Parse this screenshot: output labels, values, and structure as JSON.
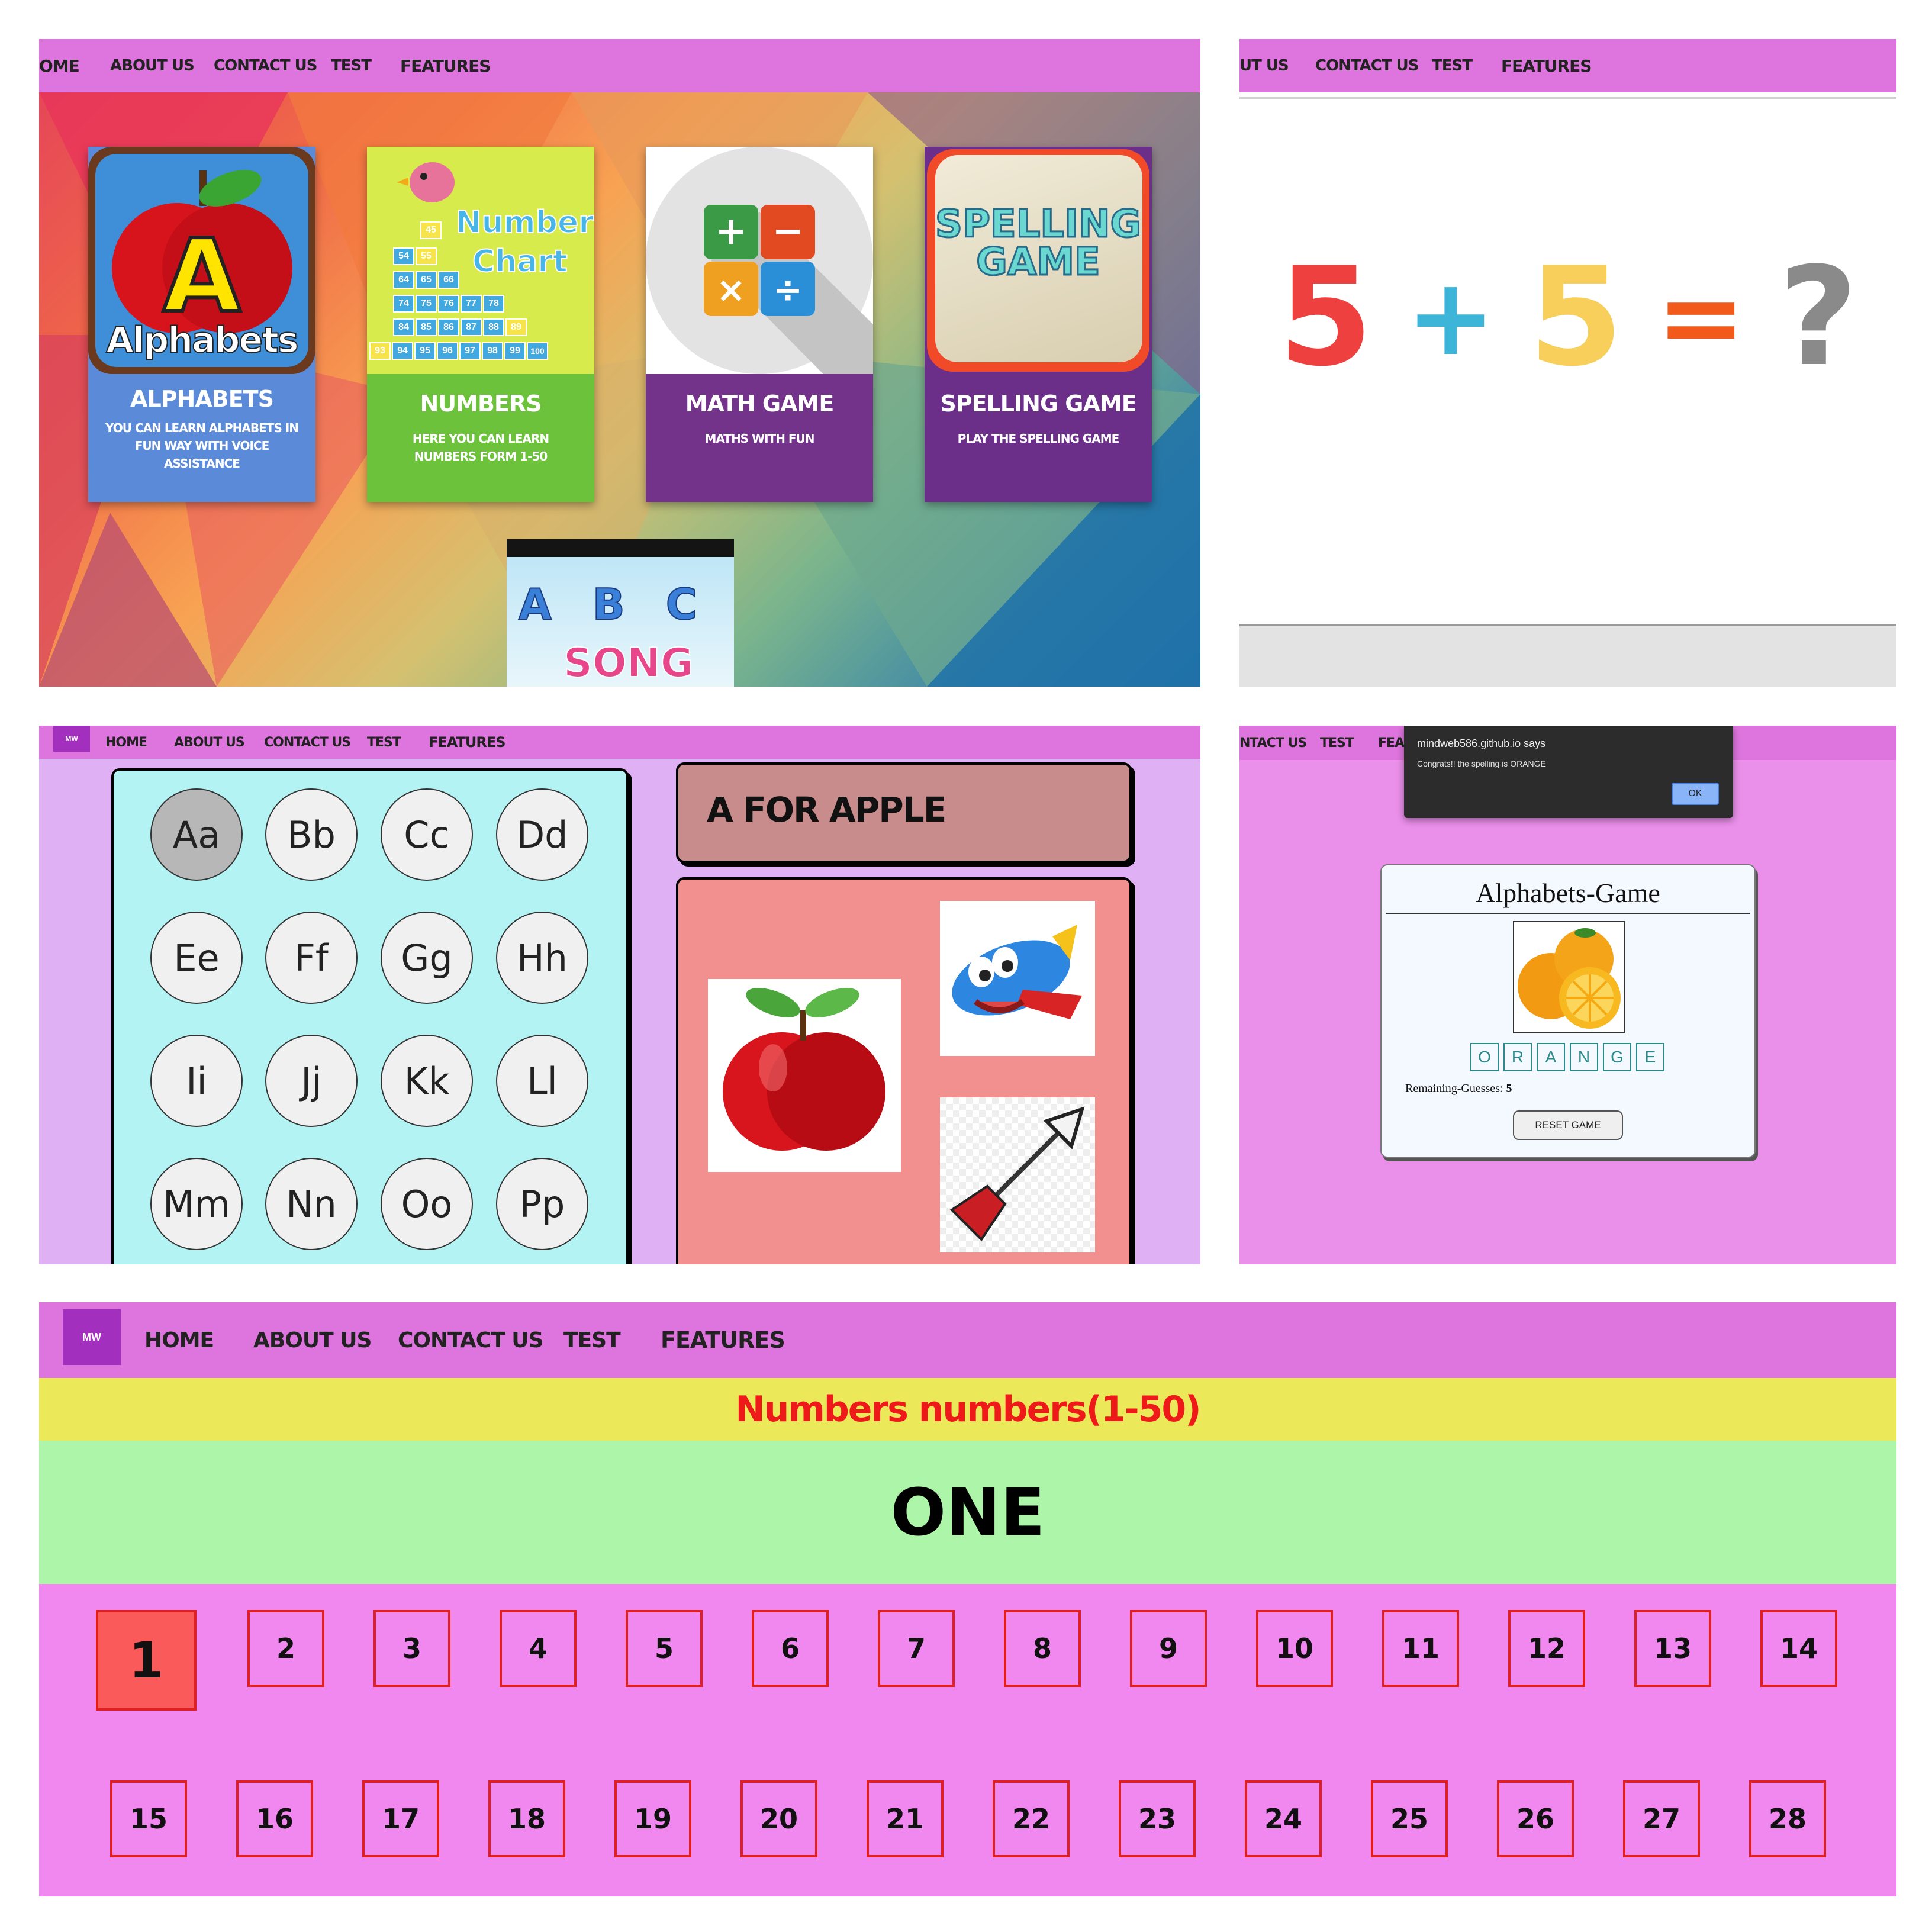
{
  "nav": {
    "home": "Home",
    "about": "About us",
    "contact": "Contact us",
    "test": "Test",
    "features": "Features",
    "home_cut": "ome",
    "about_cut": "UT US",
    "contact_cut": "NTACT US",
    "features_cut": "FEA",
    "logo_text": "MW"
  },
  "panel1": {
    "cards": [
      {
        "image_title": "Alphabets",
        "image_letter": "A",
        "title": "Alphabets",
        "description": "You can learn alphabets in fun way with voice assistance",
        "color": "#5b8bd8"
      },
      {
        "image_title_1": "Number",
        "image_title_2": "Chart",
        "title": "Numbers",
        "description": "Here you can learn numbers form 1-50",
        "color": "#6cc23a"
      },
      {
        "title": "Math Game",
        "description": "Maths with fun",
        "color": "#74338a"
      },
      {
        "image_title_1": "SPELLING",
        "image_title_2": "GAME",
        "title": "Spelling Game",
        "description": "Play the spelling game",
        "color": "#6b2f8a"
      }
    ],
    "song_card": {
      "letters": "A B C",
      "word": "SONG"
    },
    "number_chart_cells": [
      "45",
      "54",
      "55",
      "64",
      "65",
      "66",
      "74",
      "75",
      "76",
      "77",
      "78",
      "84",
      "85",
      "86",
      "87",
      "88",
      "89",
      "93",
      "94",
      "95",
      "96",
      "97",
      "98",
      "99",
      "100"
    ]
  },
  "panel2": {
    "equation": [
      "5",
      "+",
      "5",
      "=",
      "?"
    ]
  },
  "panel3": {
    "letters": [
      "Aa",
      "Bb",
      "Cc",
      "Dd",
      "Ee",
      "Ff",
      "Gg",
      "Hh",
      "Ii",
      "Jj",
      "Kk",
      "Ll",
      "Mm",
      "Nn",
      "Oo",
      "Pp"
    ],
    "heading": "A FOR APPLE"
  },
  "panel4": {
    "dialog": {
      "origin": "mindweb586.github.io says",
      "message": "Congrats!! the spelling is ORANGE",
      "ok": "OK"
    },
    "game": {
      "title": "Alphabets-Game",
      "letters": [
        "O",
        "R",
        "A",
        "N",
        "G",
        "E"
      ],
      "remaining_label": "Remaining-Guesses:",
      "remaining_value": "5",
      "reset": "RESET GAME"
    }
  },
  "panel5": {
    "banner": "Numbers numbers(1-50)",
    "word": "ONE",
    "numbers": [
      "1",
      "2",
      "3",
      "4",
      "5",
      "6",
      "7",
      "8",
      "9",
      "10",
      "11",
      "12",
      "13",
      "14",
      "15",
      "16",
      "17",
      "18",
      "19",
      "20",
      "21",
      "22",
      "23",
      "24",
      "25",
      "26",
      "27",
      "28"
    ],
    "selected": "1"
  }
}
